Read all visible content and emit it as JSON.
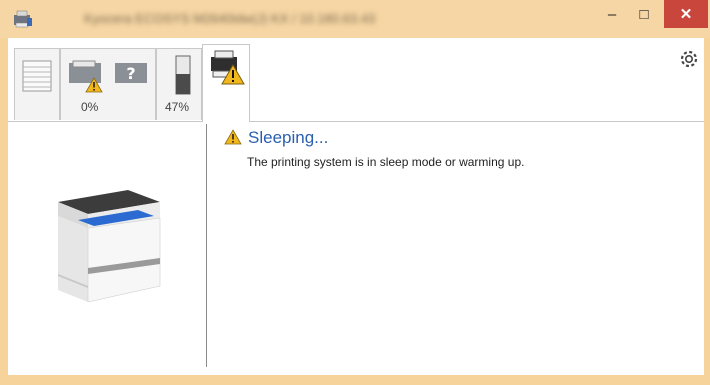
{
  "window": {
    "title": "Kyocera ECOSYS M2640idw(J) KX / 10.180.63.43",
    "minimize_label": "–",
    "maximize_label": "□",
    "close_label": "✕"
  },
  "tabs": [
    {
      "name": "paper-tab"
    },
    {
      "name": "tray-tab",
      "value": "0%"
    },
    {
      "name": "toner-tab",
      "value": "47%"
    },
    {
      "name": "device-status-tab"
    }
  ],
  "status": {
    "title": "Sleeping...",
    "message": "The printing system is in sleep mode or warming up."
  },
  "toolbar": {
    "collapse_label": "▲"
  },
  "colors": {
    "titlebar": "#f6d6a4",
    "close_button": "#c9463d",
    "status_title": "#2a5fb0",
    "warning": "#f3b71e"
  },
  "icons": {
    "settings": "gear-icon",
    "warning": "warning-icon"
  }
}
